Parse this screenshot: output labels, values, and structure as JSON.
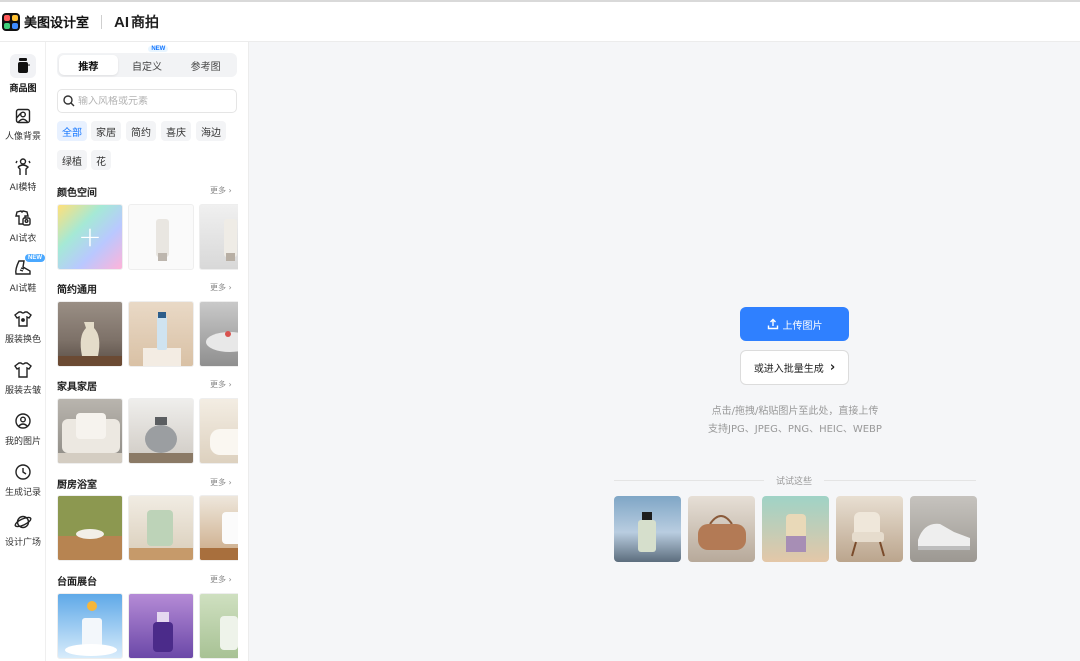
{
  "header": {
    "brand": "美图设计室",
    "product_prefix": "AI",
    "product_name": "商拍"
  },
  "nav": [
    {
      "label": "商品图",
      "icon": "product-icon",
      "active": true
    },
    {
      "label": "人像背景",
      "icon": "portrait-background-icon"
    },
    {
      "label": "AI模特",
      "icon": "model-icon"
    },
    {
      "label": "AI试衣",
      "icon": "try-on-icon"
    },
    {
      "label": "AI试鞋",
      "icon": "shoe-icon",
      "badge": "NEW"
    },
    {
      "label": "服装换色",
      "icon": "shirt-color-icon"
    },
    {
      "label": "服装去皱",
      "icon": "shirt-icon"
    },
    {
      "label": "我的图片",
      "icon": "user-icon"
    },
    {
      "label": "生成记录",
      "icon": "clock-icon"
    },
    {
      "label": "设计广场",
      "icon": "planet-icon"
    }
  ],
  "tabs": [
    {
      "label": "推荐",
      "active": true
    },
    {
      "label": "自定义",
      "badge": "NEW"
    },
    {
      "label": "参考图"
    }
  ],
  "search": {
    "placeholder": "输入风格或元素"
  },
  "chips": [
    {
      "label": "全部",
      "active": true
    },
    {
      "label": "家居"
    },
    {
      "label": "简约"
    },
    {
      "label": "喜庆"
    },
    {
      "label": "海边"
    },
    {
      "label": "绿植"
    },
    {
      "label": "花"
    }
  ],
  "sections": [
    {
      "title": "颜色空间",
      "more": "更多"
    },
    {
      "title": "简约通用",
      "more": "更多"
    },
    {
      "title": "家具家居",
      "more": "更多"
    },
    {
      "title": "厨房浴室",
      "more": "更多"
    },
    {
      "title": "台面展台",
      "more": "更多"
    }
  ],
  "main": {
    "upload_label": "上传图片",
    "batch_label": "或进入批量生成",
    "hint_line1": "点击/拖拽/粘贴图片至此处，直接上传",
    "hint_line2": "支持JPG、JPEG、PNG、HEIC、WEBP",
    "try_label": "试试这些"
  },
  "colors": {
    "accent": "#2f80ff",
    "chip_active_bg": "#e8f1ff",
    "new_badge": "#4aa8ff"
  }
}
